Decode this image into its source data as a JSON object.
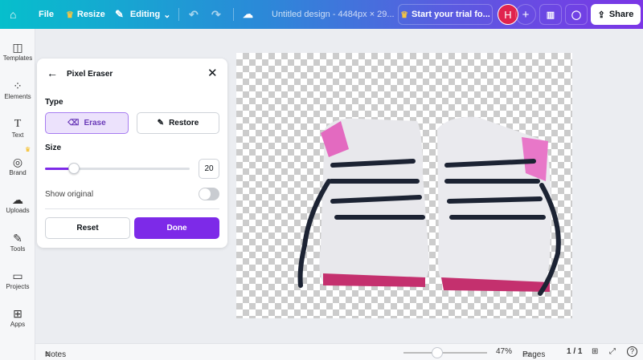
{
  "topbar": {
    "file": "File",
    "resize": "Resize",
    "editing": "Editing",
    "title": "Untitled design - 4484px × 29...",
    "trial": "Start your trial fo...",
    "avatar": "H",
    "share": "Share"
  },
  "sidebar": {
    "items": [
      {
        "label": "Templates",
        "icon": "template-icon"
      },
      {
        "label": "Elements",
        "icon": "elements-icon"
      },
      {
        "label": "Text",
        "icon": "text-icon"
      },
      {
        "label": "Brand",
        "icon": "brand-icon"
      },
      {
        "label": "Uploads",
        "icon": "upload-icon"
      },
      {
        "label": "Tools",
        "icon": "tools-icon"
      },
      {
        "label": "Projects",
        "icon": "folder-icon"
      },
      {
        "label": "Apps",
        "icon": "apps-icon"
      }
    ]
  },
  "panel": {
    "title": "Pixel Eraser",
    "type_label": "Type",
    "erase": "Erase",
    "restore": "Restore",
    "size_label": "Size",
    "size_value": "20",
    "size_fraction": 0.2,
    "show_original": "Show original",
    "show_original_on": false,
    "reset": "Reset",
    "done": "Done"
  },
  "footer": {
    "notes": "Notes",
    "zoom": "47%",
    "zoom_fraction": 0.4,
    "pages": "Pages",
    "page_count": "1 / 1"
  },
  "colors": {
    "accent": "#7d2ae8",
    "avatar": "#e0234e"
  }
}
